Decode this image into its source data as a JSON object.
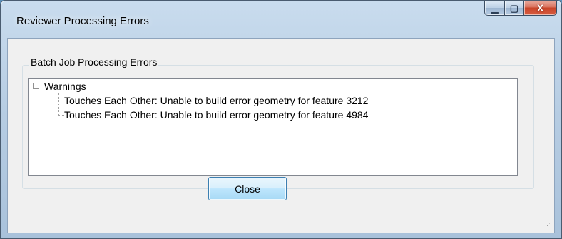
{
  "window": {
    "title": "Reviewer Processing Errors",
    "caption_buttons": {
      "minimize_glyph": "▁",
      "maximize_glyph": "▢",
      "close_glyph": "X"
    }
  },
  "group": {
    "label": "Batch Job Processing Errors"
  },
  "tree": {
    "root": {
      "label": "Warnings",
      "expanded": true,
      "children": [
        "Touches Each Other: Unable to build error geometry for feature 3212",
        "Touches Each Other: Unable to build error geometry for feature 4984"
      ]
    }
  },
  "buttons": {
    "close_label": "Close"
  },
  "colors": {
    "client_bg": "#f0f0f0",
    "title_close_button": "#c8452a",
    "button_accent": "#3c7fb1"
  }
}
